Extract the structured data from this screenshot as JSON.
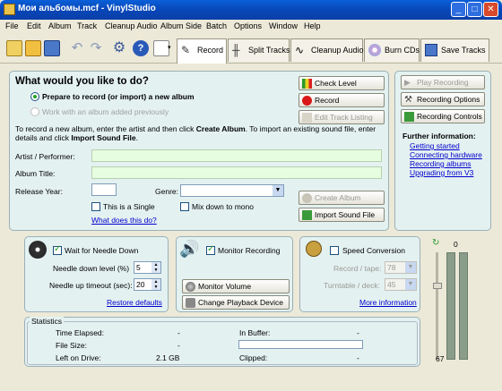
{
  "window": {
    "title": "Мои альбомы.mcf - VinylStudio",
    "minimize": "_",
    "maximize": "□",
    "close": "✕"
  },
  "menu": [
    "File",
    "Edit",
    "Album",
    "Track",
    "Cleanup Audio",
    "Album Side",
    "Batch",
    "Options",
    "Window",
    "Help"
  ],
  "toolbar": {
    "icons": [
      "new-album-icon",
      "open-folder-icon",
      "save-icon",
      "undo-icon",
      "redo-icon",
      "settings-icon",
      "help-icon",
      "new-document-icon"
    ],
    "tabs": [
      "Record",
      "Split Tracks",
      "Cleanup Audio",
      "Burn CDs",
      "Save Tracks"
    ]
  },
  "main": {
    "heading": "What would you like to do?",
    "option_prepare": "Prepare to record (or import) a new album",
    "option_existing": "Work with an album added previously",
    "instructions_1": "To record a new album, enter the artist and then click ",
    "instructions_bold1": "Create Album",
    "instructions_2": ".  To import an existing sound file, enter details and click ",
    "instructions_bold2": "Import Sound File",
    "instructions_3": ".",
    "artist_label": "Artist / Performer:",
    "album_title_label": "Album Title:",
    "release_year_label": "Release Year:",
    "genre_label": "Genre:",
    "single_label": "This is a Single",
    "mixdown_label": "Mix down to mono",
    "whatdoes_link": "What does this do?",
    "buttons": {
      "check_level": "Check Level",
      "record": "Record",
      "edit_track_listing": "Edit Track Listing",
      "create_album": "Create Album",
      "import_sound_file": "Import Sound File"
    }
  },
  "side": {
    "play_recording": "Play Recording",
    "recording_options": "Recording Options",
    "recording_controls": "Recording Controls",
    "further_info": "Further information:",
    "links": [
      "Getting started",
      "Connecting hardware",
      "Recording albums",
      "Upgrading from V3"
    ]
  },
  "needle": {
    "wait_label": "Wait for Needle Down",
    "level_label": "Needle down level (%)",
    "level_value": "5",
    "timeout_label": "Needle up timeout (sec):",
    "timeout_value": "20",
    "restore_link": "Restore defaults"
  },
  "monitor": {
    "monitor_label": "Monitor Recording",
    "monitor_volume": "Monitor Volume",
    "change_device": "Change Playback Device"
  },
  "speed": {
    "speed_label": "Speed Conversion",
    "record_tape_label": "Record / tape:",
    "record_tape_value": "78",
    "turntable_label": "Turntable / deck:",
    "turntable_value": "45",
    "more_info_link": "More information"
  },
  "level_meter": {
    "top_value": "0",
    "bottom_value": "67"
  },
  "stats": {
    "legend": "Statistics",
    "time_elapsed_label": "Time Elapsed:",
    "time_elapsed_value": "-",
    "file_size_label": "File Size:",
    "file_size_value": "-",
    "left_on_drive_label": "Left on Drive:",
    "left_on_drive_value": "2.1 GB",
    "in_buffer_label": "In Buffer:",
    "in_buffer_value": "-",
    "clipped_label": "Clipped:",
    "clipped_value": "-"
  }
}
